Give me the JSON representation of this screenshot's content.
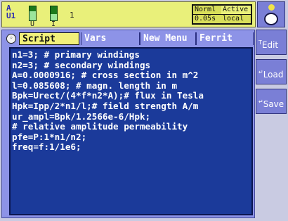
{
  "status": {
    "channel_label": "A\nU1",
    "meters": [
      {
        "label": "U",
        "level": 0.65
      },
      {
        "label": "I",
        "level": 0.45
      }
    ],
    "channel_number": "1",
    "mode": {
      "row1_left": "Norml",
      "row1_right": "Active",
      "row2_left": "0.05s",
      "row2_right": "local"
    }
  },
  "tabs": [
    {
      "label": "Script"
    },
    {
      "label": "Vars"
    },
    {
      "label": "New Menu"
    },
    {
      "label": "Ferrit"
    }
  ],
  "code_lines": [
    "n1=3; # primary windings",
    "n2=3; # secondary windings",
    "A=0.0000916; # cross section in m^2",
    "l=0.085608; # magn. length in m",
    "Bpk=Urect/(4*f*n2*A);# flux in Tesla",
    "Hpk=Ipp/2*n1/l;# field strength A/m",
    "ur_ampl=Bpk/1.2566e-6/Hpk;",
    "# relative amplitude permeability",
    "pfe=P:1*n1/n2;",
    "freq=f:1/1e6;"
  ],
  "side_buttons": [
    {
      "label": "Edit"
    },
    {
      "label": "Load"
    },
    {
      "label": "Save"
    }
  ],
  "icons": {
    "menu_icon": "circle-menu-icon",
    "person_icon": "user-help-icon"
  }
}
